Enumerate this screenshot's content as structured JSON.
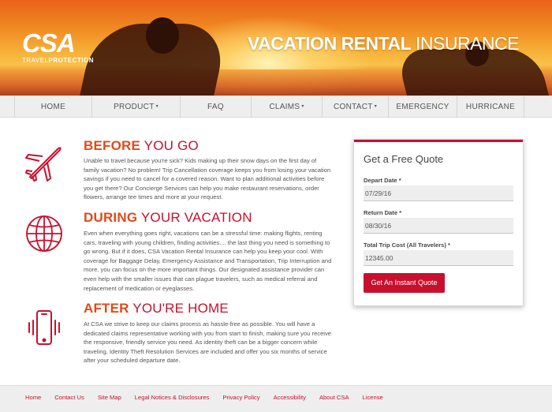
{
  "brand": {
    "logo_main": "CSA",
    "logo_sub_a": "TRAVEL",
    "logo_sub_b": "PROTECTION",
    "hero_title_bold": "VACATION RENTAL",
    "hero_title_light": " INSURANCE"
  },
  "nav": {
    "items": [
      {
        "label": "HOME",
        "dropdown": false
      },
      {
        "label": "PRODUCT",
        "dropdown": true
      },
      {
        "label": "FAQ",
        "dropdown": false
      },
      {
        "label": "CLAIMS",
        "dropdown": true
      },
      {
        "label": "CONTACT",
        "dropdown": true
      },
      {
        "label": "EMERGENCY",
        "dropdown": false
      },
      {
        "label": "HURRICANE",
        "dropdown": false
      }
    ],
    "caret": "▾"
  },
  "sections": [
    {
      "icon": "airplane-icon",
      "title_bold": "BEFORE",
      "title_rest": " YOU GO",
      "body": "Unable to travel because you're sick? Kids making up their snow days on the first day of family vacation? No problem! Trip Cancellation coverage keeps you from losing your vacation savings if you need to cancel for a covered reason. Want to plan additional activities before you get there? Our Concierge Services can help you make restaurant reservations, order flowers, arrange tee times and more at your request."
    },
    {
      "icon": "globe-icon",
      "title_bold": "DURING",
      "title_rest": " YOUR VACATION",
      "body": "Even when everything goes right, vacations can be a stressful time: making flights, renting cars, traveling with young children, finding activities.... the last thing you need is something to go wrong. But if it does, CSA Vacation Rental Insurance can help you keep your cool. With coverage for Baggage Delay, Emergency Assistance and Transportation, Trip Interruption and more, you can focus on the more important things. Our designated assistance provider can even help with the smaller issues that can plague travelers, such as medical referral and replacement of medication or eyeglasses."
    },
    {
      "icon": "phone-icon",
      "title_bold": "AFTER",
      "title_rest": " YOU'RE HOME",
      "body": "At CSA we strive to keep our claims process as hassle-free as possible. You will have a dedicated claims representative working with you from start to finish, making sure you receive the responsive, friendly service you need. As identity theft can be a bigger concern while traveling, Identity Theft Resolution Services are included and offer you six months of service after your scheduled departure date."
    }
  ],
  "quote": {
    "title": "Get a Free Quote",
    "depart_label": "Depart Date *",
    "depart_value": "07/29/16",
    "return_label": "Return Date *",
    "return_value": "08/30/16",
    "cost_label": "Total Trip Cost (All Travelers) *",
    "cost_value": "12345.00",
    "button": "Get An Instant Quote"
  },
  "footer": {
    "links": [
      "Home",
      "Contact Us",
      "Site Map",
      "Legal Notices & Disclosures",
      "Privacy Policy",
      "Accessibility",
      "About CSA",
      "License"
    ]
  },
  "colors": {
    "accent": "#c8102e",
    "heading": "#e04a1a"
  }
}
